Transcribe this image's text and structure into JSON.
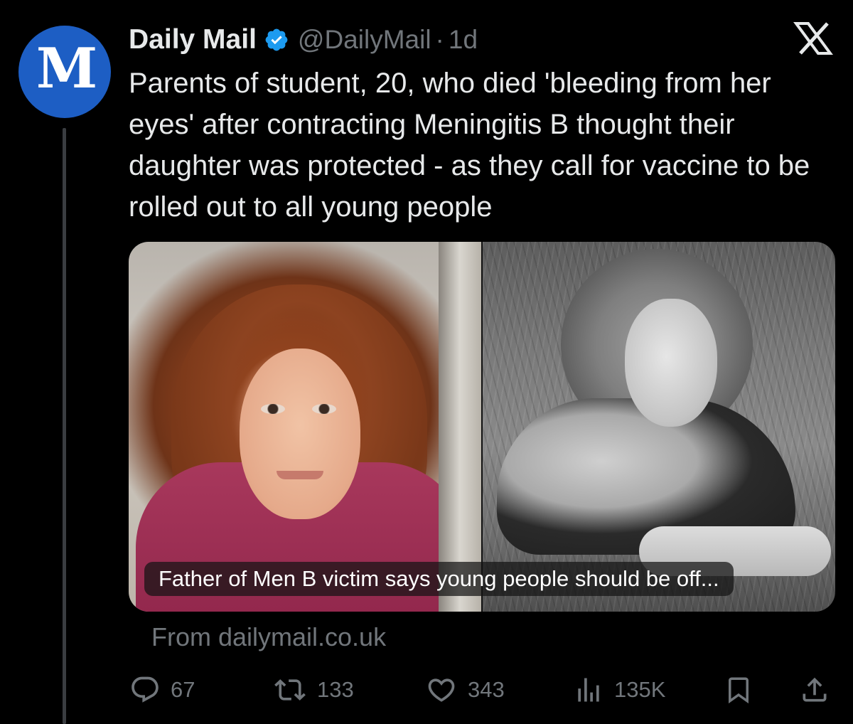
{
  "author": {
    "name": "Daily Mail",
    "handle": "@DailyMail",
    "separator": "·",
    "time": "1d",
    "avatar_text": "M",
    "verified": true
  },
  "tweet": {
    "text": "Parents of student, 20, who died 'bleeding from her eyes' after contracting Meningitis B thought their daughter was protected - as they call for vaccine to be rolled out to all young people"
  },
  "media": {
    "caption": "Father of Men B victim says young people should be off..."
  },
  "card": {
    "source": "From dailymail.co.uk"
  },
  "actions": {
    "replies": "67",
    "reposts": "133",
    "likes": "343",
    "views": "135K"
  },
  "icons": {
    "brand": "x-logo-icon",
    "verified": "verified-badge-icon",
    "reply": "reply-icon",
    "repost": "repost-icon",
    "like": "heart-icon",
    "views": "analytics-icon",
    "bookmark": "bookmark-icon",
    "share": "share-icon"
  },
  "colors": {
    "background": "#000000",
    "avatar": "#1d5ec4",
    "verified": "#1d9bf0",
    "muted": "#71767b",
    "text": "#e7e9ea"
  }
}
